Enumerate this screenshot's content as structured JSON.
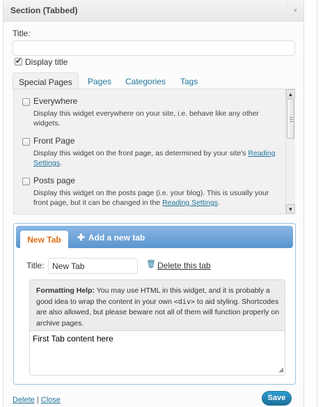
{
  "widget": {
    "title": "Section (Tabbed)",
    "toggle_glyph": "▼"
  },
  "title_field": {
    "label": "Title:",
    "value": ""
  },
  "display_title": {
    "label": "Display title",
    "checked": true
  },
  "page_tabs": [
    "Special Pages",
    "Pages",
    "Categories",
    "Tags"
  ],
  "special_pages": [
    {
      "title": "Everywhere",
      "desc": "Display this widget everywhere on your site, i.e. behave like any other widgets.",
      "checked": false
    },
    {
      "title": "Front Page",
      "desc_prefix": "Display this widget on the front page, as determined by your site's",
      "link": "Reading Settings",
      "desc_suffix": ".",
      "checked": false
    },
    {
      "title": "Posts page",
      "desc_prefix": "Display this widget on the posts page (i.e. your blog). This is usually your front page, but it can be changed in the",
      "link": "Reading Settings",
      "desc_suffix": ".",
      "checked": false
    }
  ],
  "tabs_widget": {
    "active_tab": "New Tab",
    "add_tab": "Add a new tab",
    "tab_title_label": "Title:",
    "tab_title_value": "New Tab",
    "delete_tab": "Delete this tab",
    "help_label": "Formatting Help:",
    "help_text_1": "You may use HTML in this widget, and it is probably a good idea to wrap the content in your own",
    "help_code": "<div>",
    "help_text_2": "to aid styling. Shortcodes are also allowed, but please beware not all of them will function properly on archive pages.",
    "content": "First Tab content here"
  },
  "footer": {
    "delete": "Delete",
    "separator": "|",
    "close": "Close",
    "save": "Save"
  },
  "colors": {
    "link": "#21759b",
    "tab_header": "#5a95cf",
    "active_tab_text": "#e06e1a",
    "save_button": "#21759b"
  }
}
